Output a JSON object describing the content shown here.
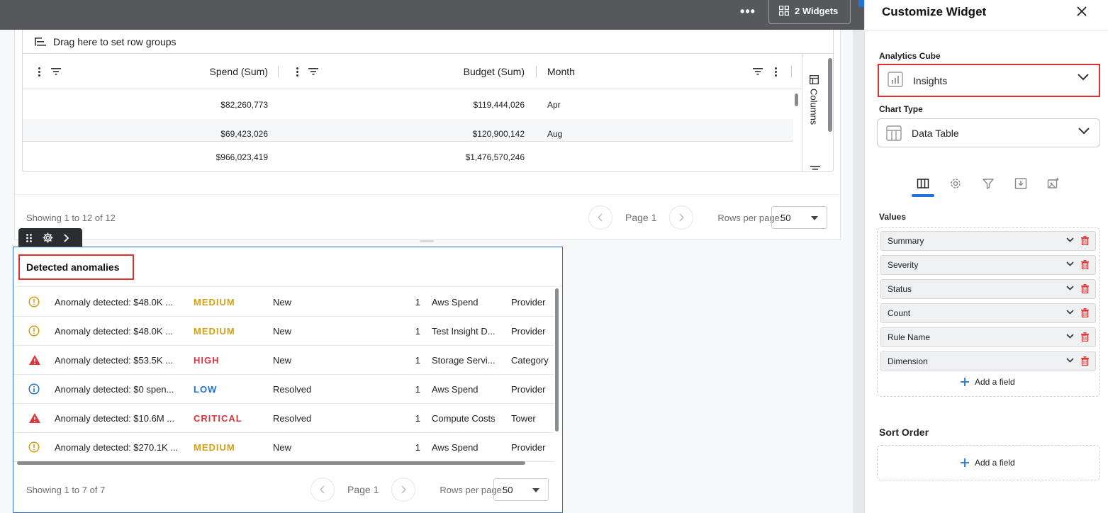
{
  "topbar": {
    "more_label": "•••",
    "widgets_label": "2 Widgets"
  },
  "widget1": {
    "rowgroups_label": "Drag here to set row groups",
    "columns": [
      {
        "label": "Spend (Sum)"
      },
      {
        "label": "Budget (Sum)"
      },
      {
        "label": "Month"
      }
    ],
    "rows": [
      {
        "spend": "$82,260,773",
        "budget": "$119,444,026",
        "month": "Apr"
      },
      {
        "spend": "$69,423,026",
        "budget": "$120,900,142",
        "month": "Aug"
      }
    ],
    "totals": {
      "spend": "$966,023,419",
      "budget": "$1,476,570,246"
    },
    "columns_panel_label": "Columns",
    "showing": "Showing 1 to 12 of 12",
    "page_label": "Page 1",
    "rows_per_page_label": "Rows per page:",
    "rows_per_page_value": "50"
  },
  "widget2": {
    "title": "Detected anomalies",
    "rows": [
      {
        "icon": "warning-circle-icon",
        "summary": "Anomaly detected: $48.0K ...",
        "severity": "MEDIUM",
        "status": "New",
        "count": "1",
        "rule": "Aws Spend",
        "dimension": "Provider"
      },
      {
        "icon": "warning-circle-icon",
        "summary": "Anomaly detected: $48.0K ...",
        "severity": "MEDIUM",
        "status": "New",
        "count": "1",
        "rule": "Test Insight D...",
        "dimension": "Provider"
      },
      {
        "icon": "alert-triangle-icon",
        "summary": "Anomaly detected: $53.5K ...",
        "severity": "HIGH",
        "status": "New",
        "count": "1",
        "rule": "Storage Servi...",
        "dimension": "Category"
      },
      {
        "icon": "info-circle-icon",
        "summary": "Anomaly detected: $0 spen...",
        "severity": "LOW",
        "status": "Resolved",
        "count": "1",
        "rule": "Aws Spend",
        "dimension": "Provider"
      },
      {
        "icon": "alert-triangle-icon",
        "summary": "Anomaly detected: $10.6M ...",
        "severity": "CRITICAL",
        "status": "Resolved",
        "count": "1",
        "rule": "Compute Costs",
        "dimension": "Tower"
      },
      {
        "icon": "warning-circle-icon",
        "summary": "Anomaly detected: $270.1K ...",
        "severity": "MEDIUM",
        "status": "New",
        "count": "1",
        "rule": "Aws Spend",
        "dimension": "Provider"
      }
    ],
    "showing": "Showing 1 to 7 of 7",
    "page_label": "Page 1",
    "rows_per_page_label": "Rows per page:",
    "rows_per_page_value": "50"
  },
  "colors": {
    "MEDIUM": "#d4a017",
    "HIGH": "#d9363e",
    "CRITICAL": "#d9363e",
    "LOW": "#2174d5"
  },
  "panel": {
    "title": "Customize Widget",
    "analytics_cube_label": "Analytics Cube",
    "analytics_cube_value": "Insights",
    "chart_type_label": "Chart Type",
    "chart_type_value": "Data Table",
    "values_label": "Values",
    "values": [
      "Summary",
      "Severity",
      "Status",
      "Count",
      "Rule Name",
      "Dimension"
    ],
    "add_field_label": "Add a field",
    "sort_order_label": "Sort Order",
    "sort_add_field_label": "Add a field"
  }
}
